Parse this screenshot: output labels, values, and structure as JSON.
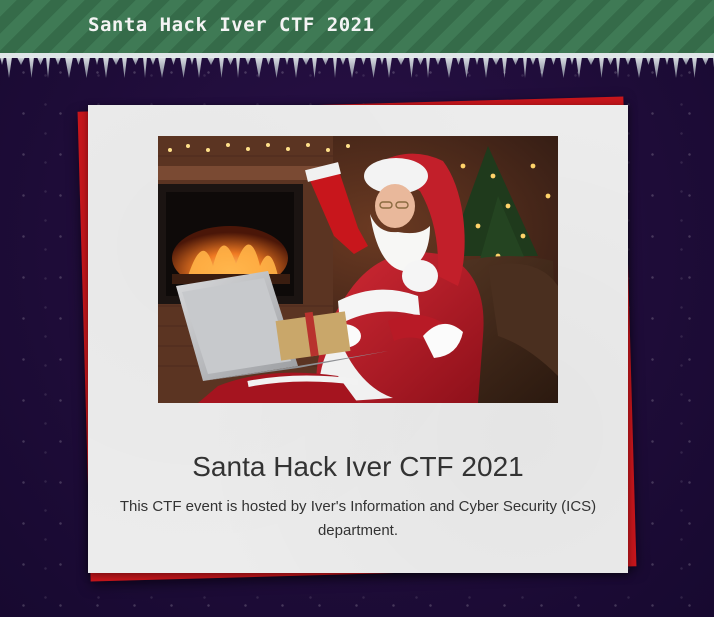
{
  "header": {
    "brand_title": "Santa Hack Iver CTF 2021",
    "brand_color": "#f4f4f4",
    "stripe_colors": [
      "#3f7a55",
      "#356b49"
    ]
  },
  "page": {
    "background_color": "#1e0c38"
  },
  "card": {
    "image_alt": "Santa Claus using a laptop by the fireplace",
    "title": "Santa Hack Iver CTF 2021",
    "description": "This CTF event is hosted by Iver's Information and Cyber Security (ICS) department.",
    "accent_color": "#c8161c",
    "background_color": "#ececec"
  }
}
